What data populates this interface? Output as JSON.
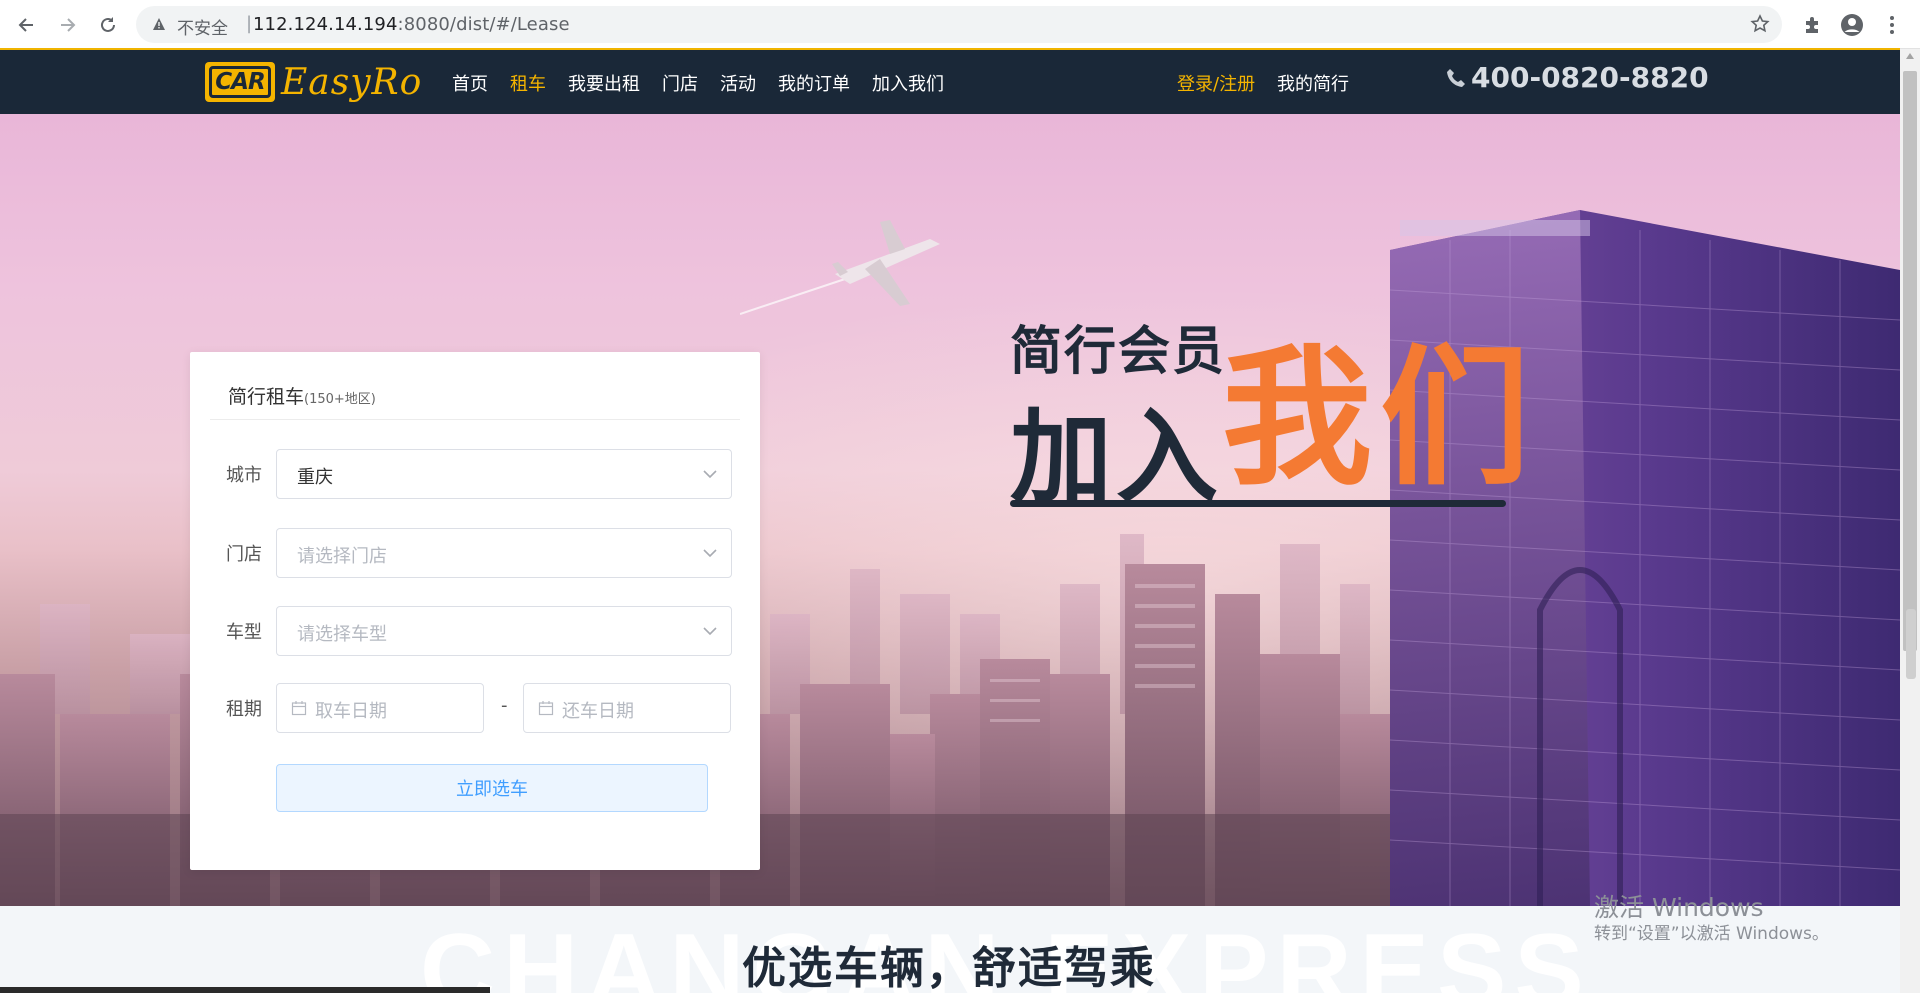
{
  "browser": {
    "security_label": "不安全",
    "separator": "|",
    "url_host": "112.124.14.194",
    "url_path": ":8080/dist/#/Lease"
  },
  "site": {
    "logo_badge": "CAR",
    "logo_text": "EasyRo",
    "nav": [
      "首页",
      "租车",
      "我要出租",
      "门店",
      "活动",
      "我的订单",
      "加入我们"
    ],
    "nav_active": "租车",
    "login": "登录/注册",
    "my_account": "我的简行",
    "phone": "400-0820-8820"
  },
  "hero": {
    "slogan_small": "简行会员",
    "slogan_big": "加入",
    "slogan_orange": "我们"
  },
  "form": {
    "title": "简行租车",
    "subtitle": "(150+地区)",
    "city_label": "城市",
    "city_value": "重庆",
    "store_label": "门店",
    "store_placeholder": "请选择门店",
    "model_label": "车型",
    "model_placeholder": "请选择车型",
    "period_label": "租期",
    "pickup_placeholder": "取车日期",
    "return_placeholder": "还车日期",
    "date_separator": "-",
    "submit_label": "立即选车"
  },
  "section": {
    "background_word": "CHANGAN EXPRESS",
    "title": "优选车辆，舒适驾乘"
  },
  "os_overlay": {
    "line1": "激活 Windows",
    "line2": "转到“设置”以激活 Windows。"
  },
  "colors": {
    "nav_bg": "#1a2838",
    "accent_yellow": "#f4b400",
    "accent_orange": "#f47a33",
    "button_text": "#409eff"
  }
}
